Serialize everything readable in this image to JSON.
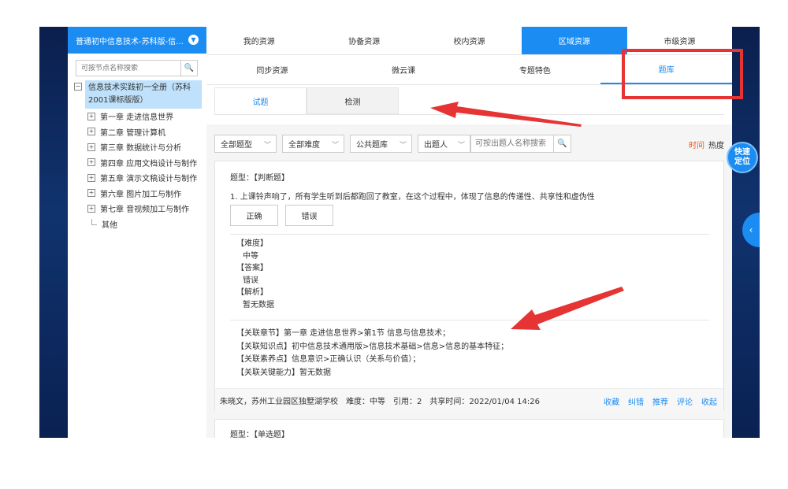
{
  "sidebar": {
    "title": "普通初中信息技术-苏科版-信...",
    "search_placeholder": "可按节点名称搜索",
    "root_label": "信息技术实践初一全册（苏科2001课标版版）",
    "chapters": [
      "第一章 走进信息世界",
      "第二章 管理计算机",
      "第三章 数据统计与分析",
      "第四章 应用文档设计与制作",
      "第五章 演示文稿设计与制作",
      "第六章 图片加工与制作",
      "第七章 音视频加工与制作"
    ],
    "other": "其他"
  },
  "tabs_level1": [
    "我的资源",
    "协备资源",
    "校内资源",
    "区域资源",
    "市级资源"
  ],
  "tabs_level2": [
    "同步资源",
    "微云课",
    "专题特色",
    "题库"
  ],
  "tabs_level3": [
    "试题",
    "检测"
  ],
  "filters": {
    "type": "全部题型",
    "difficulty": "全部难度",
    "bank": "公共题库",
    "author": "出题人",
    "search_placeholder": "可按出题人名称搜索"
  },
  "sort": {
    "time": "时间",
    "hot": "热度"
  },
  "question": {
    "type_label": "题型：【判断题】",
    "text": "1. 上课铃声响了，所有学生听到后都跑回了教室，在这个过程中，体现了信息的传递性、共享性和虚伪性",
    "options": [
      "正确",
      "错误"
    ],
    "difficulty_label": "【难度】",
    "difficulty_value": "中等",
    "answer_label": "【答案】",
    "answer_value": "错误",
    "analysis_label": "【解析】",
    "analysis_value": "暂无数据",
    "related_chapter": "【关联章节】第一章 走进信息世界>第1节 信息与信息技术；",
    "related_knowledge": "【关联知识点】初中信息技术通用版>信息技术基础>信息>信息的基本特征；",
    "related_literacy": "【关联素养点】信息意识>正确认识（关系与价值）；",
    "related_ability": "【关联关键能力】暂无数据",
    "footer": "朱晓文，苏州工业园区独墅湖学校　难度：中等　引用：2　共享时间：2022/01/04 14:26",
    "actions": [
      "收藏",
      "纠错",
      "推荐",
      "评论",
      "收起"
    ]
  },
  "question2_type_label": "题型：【单选题】",
  "quick_locate": [
    "快速",
    "定位"
  ],
  "icons": {
    "chevron": "chevron-down-icon",
    "search": "search-icon",
    "back": "chevron-left-icon"
  },
  "colors": {
    "accent": "#1b8cf2",
    "highlight": "#e63434",
    "sort_active": "#e85a1b"
  }
}
